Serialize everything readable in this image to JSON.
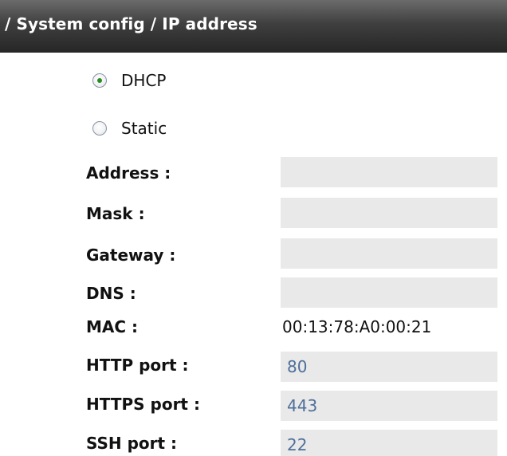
{
  "header": {
    "breadcrumb": "/ System config / IP address"
  },
  "mode": {
    "selected": "DHCP",
    "options": [
      {
        "label": "DHCP",
        "checked": true
      },
      {
        "label": "Static",
        "checked": false
      }
    ]
  },
  "fields": {
    "address": {
      "label": "Address :",
      "value": ""
    },
    "mask": {
      "label": "Mask :",
      "value": ""
    },
    "gateway": {
      "label": "Gateway :",
      "value": ""
    },
    "dns": {
      "label": "DNS :",
      "value": ""
    },
    "mac": {
      "label": "MAC :",
      "value": "00:13:78:A0:00:21"
    },
    "http_port": {
      "label": "HTTP port :",
      "value": "80"
    },
    "https_port": {
      "label": "HTTPS port :",
      "value": "443"
    },
    "ssh_port": {
      "label": "SSH port :",
      "value": "22"
    }
  },
  "colors": {
    "header_dark": "#262626",
    "field_background": "#e9e9e9",
    "port_value_text": "#4e6f9a",
    "radio_selected_dot": "#2a8a24"
  },
  "icons": {
    "radio_selected": "radio-selected-icon",
    "radio_unselected": "radio-unselected-icon"
  }
}
